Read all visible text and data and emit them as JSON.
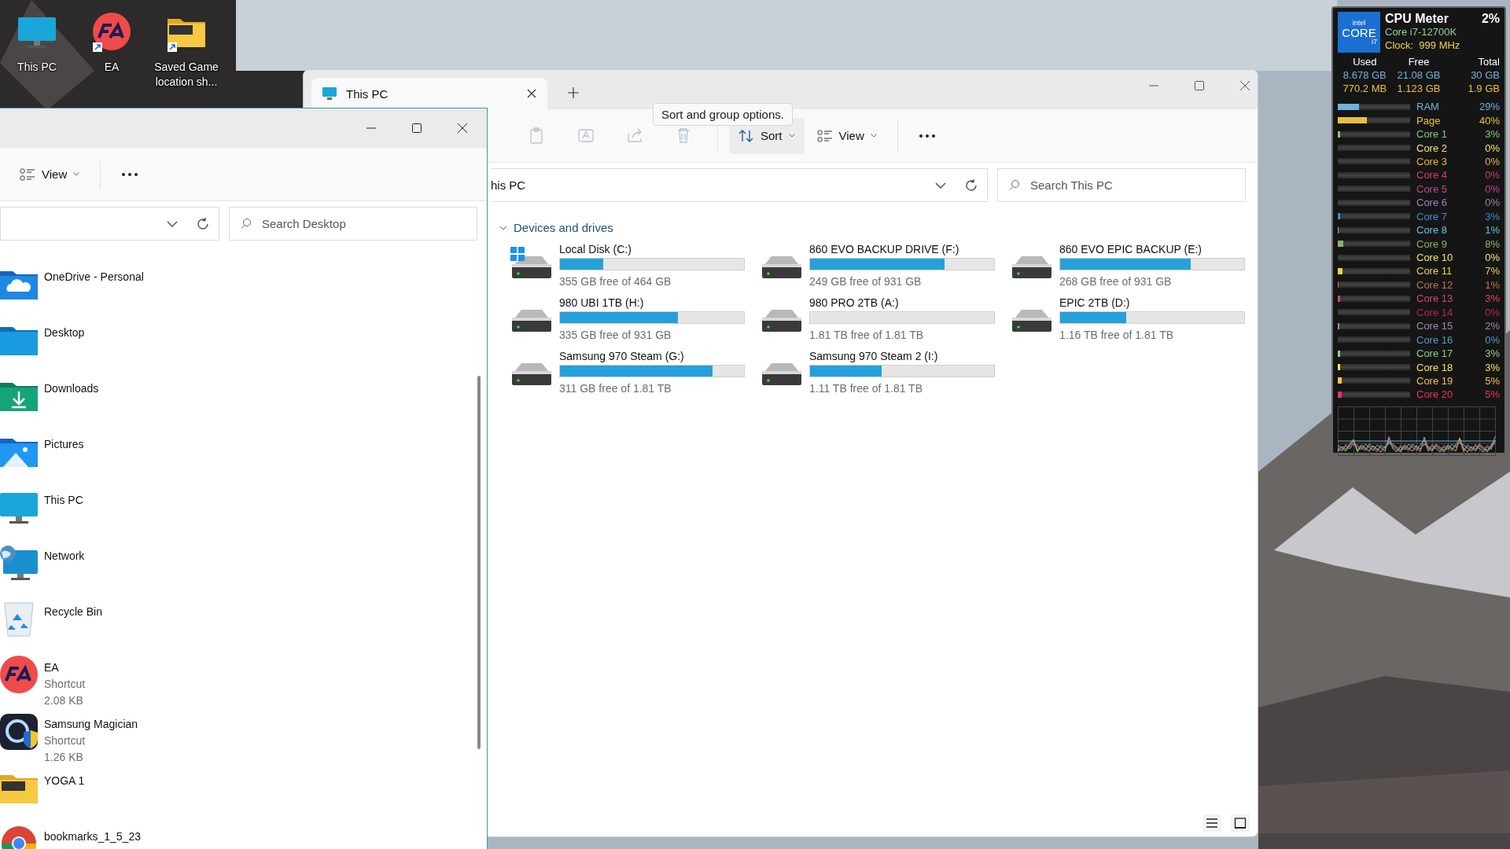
{
  "desktop_icons": [
    {
      "label": "This PC",
      "kind": "pc",
      "shortcut": false
    },
    {
      "label": "EA",
      "kind": "ea",
      "shortcut": true
    },
    {
      "label": "Saved Game location sh...",
      "kind": "yoga",
      "shortcut": true
    }
  ],
  "this_pc_window": {
    "tab": {
      "title": "This PC",
      "selected": true
    },
    "toolbar": [
      {
        "kind": "paste",
        "disabled": true
      },
      {
        "kind": "rename",
        "disabled": true
      },
      {
        "kind": "share",
        "disabled": true
      },
      {
        "kind": "delete",
        "disabled": true
      }
    ],
    "sort": {
      "label": "Sort",
      "hovered": true
    },
    "view": {
      "label": "View",
      "hovered": false
    },
    "tooltip": "Sort and group options.",
    "address": "his PC",
    "search": {
      "placeholder": "Search This PC"
    },
    "section": {
      "title": "Devices and drives",
      "expanded": true
    },
    "drives": [
      {
        "name": "Local Disk (C:)",
        "free": "355 GB free of 464 GB",
        "level": 0.235,
        "kind": "system"
      },
      {
        "name": "860 EVO BACKUP DRIVE  (F:)",
        "free": "249 GB free of 931 GB",
        "level": 0.73,
        "kind": "drive"
      },
      {
        "name": "860 EVO EPIC BACKUP (E:)",
        "free": "268 GB free of 931 GB",
        "level": 0.71,
        "kind": "drive"
      },
      {
        "name": "980 UBI 1TB (H:)",
        "free": "335 GB free of 931 GB",
        "level": 0.64,
        "kind": "drive"
      },
      {
        "name": "980 PRO 2TB (A:)",
        "free": "1.81 TB free of 1.81 TB",
        "level": 0,
        "kind": "drive"
      },
      {
        "name": "EPIC 2TB (D:)",
        "free": "1.16 TB free of 1.81 TB",
        "level": 0.36,
        "kind": "drive"
      },
      {
        "name": "Samsung 970 Steam (G:)",
        "free": "311 GB free of 1.81 TB",
        "level": 0.83,
        "kind": "drive"
      },
      {
        "name": "Samsung 970 Steam 2 (I:)",
        "free": "1.11 TB free of 1.81 TB",
        "level": 0.39,
        "kind": "drive"
      }
    ]
  },
  "desktop_window": {
    "view": {
      "label": "View"
    },
    "search": {
      "placeholder": "Search Desktop"
    },
    "items": [
      {
        "name": "OneDrive - Personal",
        "kind": "onedrive"
      },
      {
        "name": "Desktop",
        "kind": "folder"
      },
      {
        "name": "Downloads",
        "kind": "downloads"
      },
      {
        "name": "Pictures",
        "kind": "pictures"
      },
      {
        "name": "This PC",
        "kind": "pc"
      },
      {
        "name": "Network",
        "kind": "network"
      },
      {
        "name": "Recycle Bin",
        "kind": "recycle"
      },
      {
        "name": "EA",
        "kind": "ea",
        "type": "Shortcut",
        "size": "2.08 KB"
      },
      {
        "name": "Samsung Magician",
        "kind": "magician",
        "type": "Shortcut",
        "size": "1.26 KB"
      },
      {
        "name": "YOGA 1",
        "kind": "yoga"
      },
      {
        "name": "bookmarks_1_5_23",
        "kind": "chrome"
      }
    ]
  },
  "cpu_meter": {
    "logo": {
      "brand": "intel",
      "line": "CORE",
      "tier": "i7"
    },
    "title": "CPU Meter",
    "total": "2%",
    "model": "Core i7-12700K",
    "clock": "Clock:  999 MHz",
    "memory": {
      "columns": [
        "Used",
        "Free",
        "Total"
      ],
      "rows": [
        {
          "values": [
            "8.678 GB",
            "21.08 GB",
            "30 GB"
          ],
          "color": "#6fb3dc"
        },
        {
          "values": [
            "770.2 MB",
            "1.123 GB",
            "1.9 GB"
          ],
          "color": "#e8c040"
        }
      ]
    },
    "meters": [
      {
        "label": "RAM",
        "reading": "29%",
        "level": 0.29,
        "color": "#6fb3dc"
      },
      {
        "label": "Page",
        "reading": "40%",
        "level": 0.4,
        "color": "#e8c040"
      },
      {
        "label": "Core 1",
        "reading": "3%",
        "level": 0.03,
        "color": "#7ccb7c"
      },
      {
        "label": "Core 2",
        "reading": "0%",
        "level": 0,
        "color": "#f2e66a"
      },
      {
        "label": "Core 3",
        "reading": "0%",
        "level": 0,
        "color": "#e6b84a"
      },
      {
        "label": "Core 4",
        "reading": "0%",
        "level": 0,
        "color": "#d23c6c"
      },
      {
        "label": "Core 5",
        "reading": "0%",
        "level": 0,
        "color": "#c2468e"
      },
      {
        "label": "Core 6",
        "reading": "0%",
        "level": 0,
        "color": "#9a84b4"
      },
      {
        "label": "Core 7",
        "reading": "3%",
        "level": 0.03,
        "color": "#3a8ed6"
      },
      {
        "label": "Core 8",
        "reading": "1%",
        "level": 0.01,
        "color": "#62c4e6"
      },
      {
        "label": "Core 9",
        "reading": "8%",
        "level": 0.08,
        "color": "#8cb466"
      },
      {
        "label": "Core 10",
        "reading": "0%",
        "level": 0,
        "color": "#f2e66a"
      },
      {
        "label": "Core 11",
        "reading": "7%",
        "level": 0.07,
        "color": "#f0d24a"
      },
      {
        "label": "Core 12",
        "reading": "1%",
        "level": 0.01,
        "color": "#b87456"
      },
      {
        "label": "Core 13",
        "reading": "3%",
        "level": 0.03,
        "color": "#d8446e"
      },
      {
        "label": "Core 14",
        "reading": "0%",
        "level": 0,
        "color": "#b82458"
      },
      {
        "label": "Core 15",
        "reading": "2%",
        "level": 0.02,
        "color": "#a486b4"
      },
      {
        "label": "Core 16",
        "reading": "0%",
        "level": 0,
        "color": "#5c94c6"
      },
      {
        "label": "Core 17",
        "reading": "3%",
        "level": 0.03,
        "color": "#84d484"
      },
      {
        "label": "Core 18",
        "reading": "3%",
        "level": 0.03,
        "color": "#f2e458"
      },
      {
        "label": "Core 19",
        "reading": "5%",
        "level": 0.05,
        "color": "#f0c444"
      },
      {
        "label": "Core 20",
        "reading": "5%",
        "level": 0.05,
        "color": "#e63464"
      }
    ]
  }
}
